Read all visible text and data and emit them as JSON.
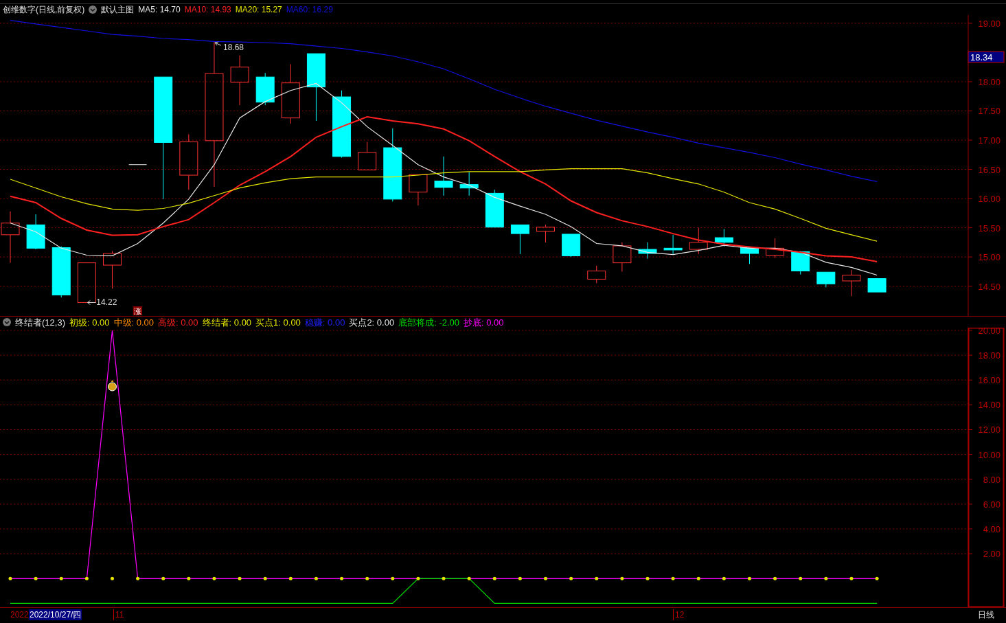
{
  "price_chart": {
    "title": "创维数字(日线,前复权)",
    "template": "默认主图",
    "legend": [
      {
        "label": "MA5: 14.70",
        "color": "#e6e6e6"
      },
      {
        "label": "MA10: 14.93",
        "color": "#ff2020"
      },
      {
        "label": "MA20: 15.27",
        "color": "#e6e600"
      },
      {
        "label": "MA60: 16.29",
        "color": "#1010e0"
      }
    ],
    "current_price": "18.34",
    "high_label": "18.68",
    "low_label": "14.22",
    "badge": "涨",
    "chart_data": {
      "type": "line",
      "grid": true,
      "ylim": [
        13.99,
        19.14
      ],
      "yticks": [
        {
          "value": 19,
          "label": "19.00"
        },
        {
          "value": 18,
          "label": "18.00"
        },
        {
          "value": 17.5,
          "label": "17.50"
        },
        {
          "value": 17,
          "label": "17.00"
        },
        {
          "value": 16.5,
          "label": "16.50"
        },
        {
          "value": 16,
          "label": "16.00"
        },
        {
          "value": 15.5,
          "label": "15.50"
        },
        {
          "value": 15,
          "label": "15.00"
        },
        {
          "value": 14.5,
          "label": "14.50"
        }
      ],
      "series": [
        {
          "color": "#e6e6e6",
          "values": [
            15.58,
            15.43,
            15.15,
            15.03,
            15.02,
            15.23,
            15.58,
            15.99,
            16.58,
            17.38,
            17.66,
            17.85,
            17.97,
            17.64,
            17.23,
            16.91,
            16.58,
            16.37,
            16.23,
            16.02,
            15.87,
            15.73,
            15.52,
            15.23,
            15.19,
            15.08,
            15.04,
            15.11,
            15.2,
            15.15,
            15.15,
            15.08,
            14.91,
            14.82,
            14.69
          ]
        },
        {
          "color": "#ff2020",
          "values": [
            16.04,
            15.93,
            15.66,
            15.46,
            15.37,
            15.38,
            15.52,
            15.64,
            15.93,
            16.23,
            16.46,
            16.72,
            17.05,
            17.23,
            17.4,
            17.33,
            17.28,
            17.19,
            16.99,
            16.72,
            16.46,
            16.25,
            15.96,
            15.76,
            15.62,
            15.52,
            15.4,
            15.29,
            15.22,
            15.17,
            15.13,
            15.08,
            15.02,
            15.0,
            14.92
          ]
        },
        {
          "color": "#e6e600",
          "values": [
            16.33,
            16.18,
            16.03,
            15.91,
            15.82,
            15.8,
            15.83,
            15.92,
            16.05,
            16.18,
            16.27,
            16.34,
            16.37,
            16.37,
            16.37,
            16.37,
            16.4,
            16.44,
            16.46,
            16.46,
            16.46,
            16.49,
            16.51,
            16.51,
            16.51,
            16.44,
            16.34,
            16.25,
            16.11,
            15.93,
            15.82,
            15.66,
            15.49,
            15.38,
            15.27
          ]
        },
        {
          "color": "#1010e0",
          "values": [
            19.05,
            18.99,
            18.93,
            18.87,
            18.81,
            18.78,
            18.74,
            18.72,
            18.69,
            18.68,
            18.67,
            18.65,
            18.61,
            18.57,
            18.51,
            18.44,
            18.34,
            18.22,
            18.05,
            17.87,
            17.72,
            17.58,
            17.46,
            17.34,
            17.24,
            17.14,
            17.05,
            16.95,
            16.87,
            16.79,
            16.7,
            16.59,
            16.49,
            16.38,
            16.29
          ]
        }
      ]
    }
  },
  "indicator": {
    "title": "终结者(12,3)",
    "legend": [
      {
        "label": "初级: 0.00",
        "color": "#e6e600"
      },
      {
        "label": "中级: 0.00",
        "color": "#ff8c00"
      },
      {
        "label": "高级: 0.00",
        "color": "#ff2020"
      },
      {
        "label": "终结者: 0.00",
        "color": "#e6e600"
      },
      {
        "label": "买点1: 0.00",
        "color": "#e6e600"
      },
      {
        "label": "稳赚: 0.00",
        "color": "#2020ff"
      },
      {
        "label": "买点2: 0.00",
        "color": "#e6e6e6"
      },
      {
        "label": "底部将成: -2.00",
        "color": "#00e000"
      },
      {
        "label": "抄底: 0.00",
        "color": "#ff00ff"
      }
    ],
    "chart_data": {
      "type": "line",
      "grid": true,
      "ylim": [
        -2.31,
        20.22
      ],
      "yticks": [
        {
          "value": 20,
          "label": "20.00"
        },
        {
          "value": 18,
          "label": "18.00"
        },
        {
          "value": 16,
          "label": "16.00"
        },
        {
          "value": 14,
          "label": "14.00"
        },
        {
          "value": 12,
          "label": "12.00"
        },
        {
          "value": 10,
          "label": "10.00"
        },
        {
          "value": 8,
          "label": "8.00"
        },
        {
          "value": 6,
          "label": "6.00"
        },
        {
          "value": 4,
          "label": "4.00"
        },
        {
          "value": 2,
          "label": "2.00"
        }
      ],
      "series": [
        {
          "color": "#ff00ff",
          "values": [
            0,
            0,
            0,
            0,
            20,
            0,
            0,
            0,
            0,
            0,
            0,
            0,
            0,
            0,
            0,
            0,
            0,
            0,
            0,
            0,
            0,
            0,
            0,
            0,
            0,
            0,
            0,
            0,
            0,
            0,
            0,
            0,
            0,
            0,
            0
          ]
        },
        {
          "color": "#00e000",
          "values": [
            -2,
            -2,
            -2,
            -2,
            -2,
            -2,
            -2,
            -2,
            -2,
            -2,
            -2,
            -2,
            -2,
            -2,
            -2,
            -2,
            0,
            0,
            0,
            -2,
            -2,
            -2,
            -2,
            -2,
            -2,
            -2,
            -2,
            -2,
            -2,
            -2,
            -2,
            -2,
            -2,
            -2,
            -2
          ]
        }
      ]
    }
  },
  "time_axis": {
    "labels": [
      {
        "text": "2022",
        "kind": "year"
      },
      {
        "text": "2022/10/27/四",
        "kind": "cursor"
      },
      {
        "text": "11",
        "kind": "month"
      },
      {
        "text": "12",
        "kind": "month"
      }
    ],
    "period": "日线"
  }
}
